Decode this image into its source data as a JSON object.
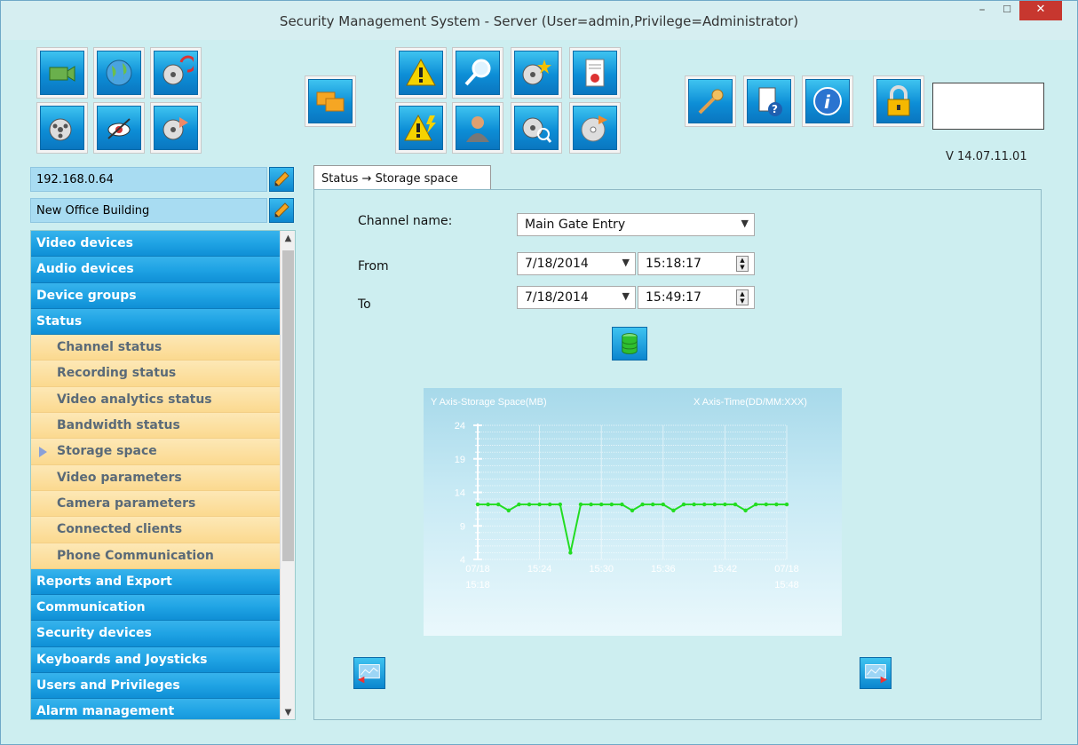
{
  "window": {
    "title": "Security Management System - Server (User=admin,Privilege=Administrator)",
    "minimize_label": "–",
    "maximize_label": "☐",
    "close_label": "✕"
  },
  "toolbar": {
    "version": "V 14.07.11.01",
    "password_value": ""
  },
  "site": {
    "ip": "192.168.0.64",
    "name": "New Office Building"
  },
  "nav": {
    "top_items": [
      {
        "label": "Video devices"
      },
      {
        "label": "Audio devices"
      },
      {
        "label": "Device groups"
      },
      {
        "label": "Status"
      }
    ],
    "sub_items": [
      {
        "label": "Channel status"
      },
      {
        "label": "Recording status"
      },
      {
        "label": "Video analytics status"
      },
      {
        "label": "Bandwidth status"
      },
      {
        "label": "Storage space",
        "selected": true
      },
      {
        "label": "Video parameters"
      },
      {
        "label": "Camera parameters"
      },
      {
        "label": "Connected clients"
      },
      {
        "label": "Phone Communication"
      }
    ],
    "bottom_items": [
      {
        "label": "Reports and Export"
      },
      {
        "label": "Communication"
      },
      {
        "label": "Security devices"
      },
      {
        "label": "Keyboards and Joysticks"
      },
      {
        "label": "Users and Privileges"
      },
      {
        "label": "Alarm management"
      }
    ]
  },
  "tab": {
    "label": "Status → Storage space"
  },
  "form": {
    "channel_label": "Channel name:",
    "channel_value": "Main Gate Entry",
    "from_label": "From",
    "from_date": "7/18/2014",
    "from_time": "15:18:17",
    "to_label": "To",
    "to_date": "7/18/2014",
    "to_time": "15:49:17"
  },
  "chart_data": {
    "type": "line",
    "ylabel": "Y Axis-Storage Space(MB)",
    "xlabel": "X Axis-Time(DD/MM:XXX)",
    "ylim": [
      4,
      24
    ],
    "yticks": [
      "24",
      "19",
      "14",
      "9",
      "4"
    ],
    "xticks": [
      {
        "top": "07/18",
        "bottom": "15:18"
      },
      {
        "top": "15:24",
        "bottom": ""
      },
      {
        "top": "15:30",
        "bottom": ""
      },
      {
        "top": "15:36",
        "bottom": ""
      },
      {
        "top": "15:42",
        "bottom": ""
      },
      {
        "top": "07/18",
        "bottom": "15:48"
      }
    ],
    "grid": true,
    "series": [
      {
        "values": [
          12.2,
          12.2,
          12.2,
          11.3,
          12.2,
          12.2,
          12.2,
          12.2,
          12.2,
          5.0,
          12.2,
          12.2,
          12.2,
          12.2,
          12.2,
          11.3,
          12.2,
          12.2,
          12.2,
          11.3,
          12.2,
          12.2,
          12.2,
          12.2,
          12.2,
          12.2,
          11.3,
          12.2,
          12.2,
          12.2,
          12.2
        ],
        "color": "#22dd22"
      }
    ]
  }
}
